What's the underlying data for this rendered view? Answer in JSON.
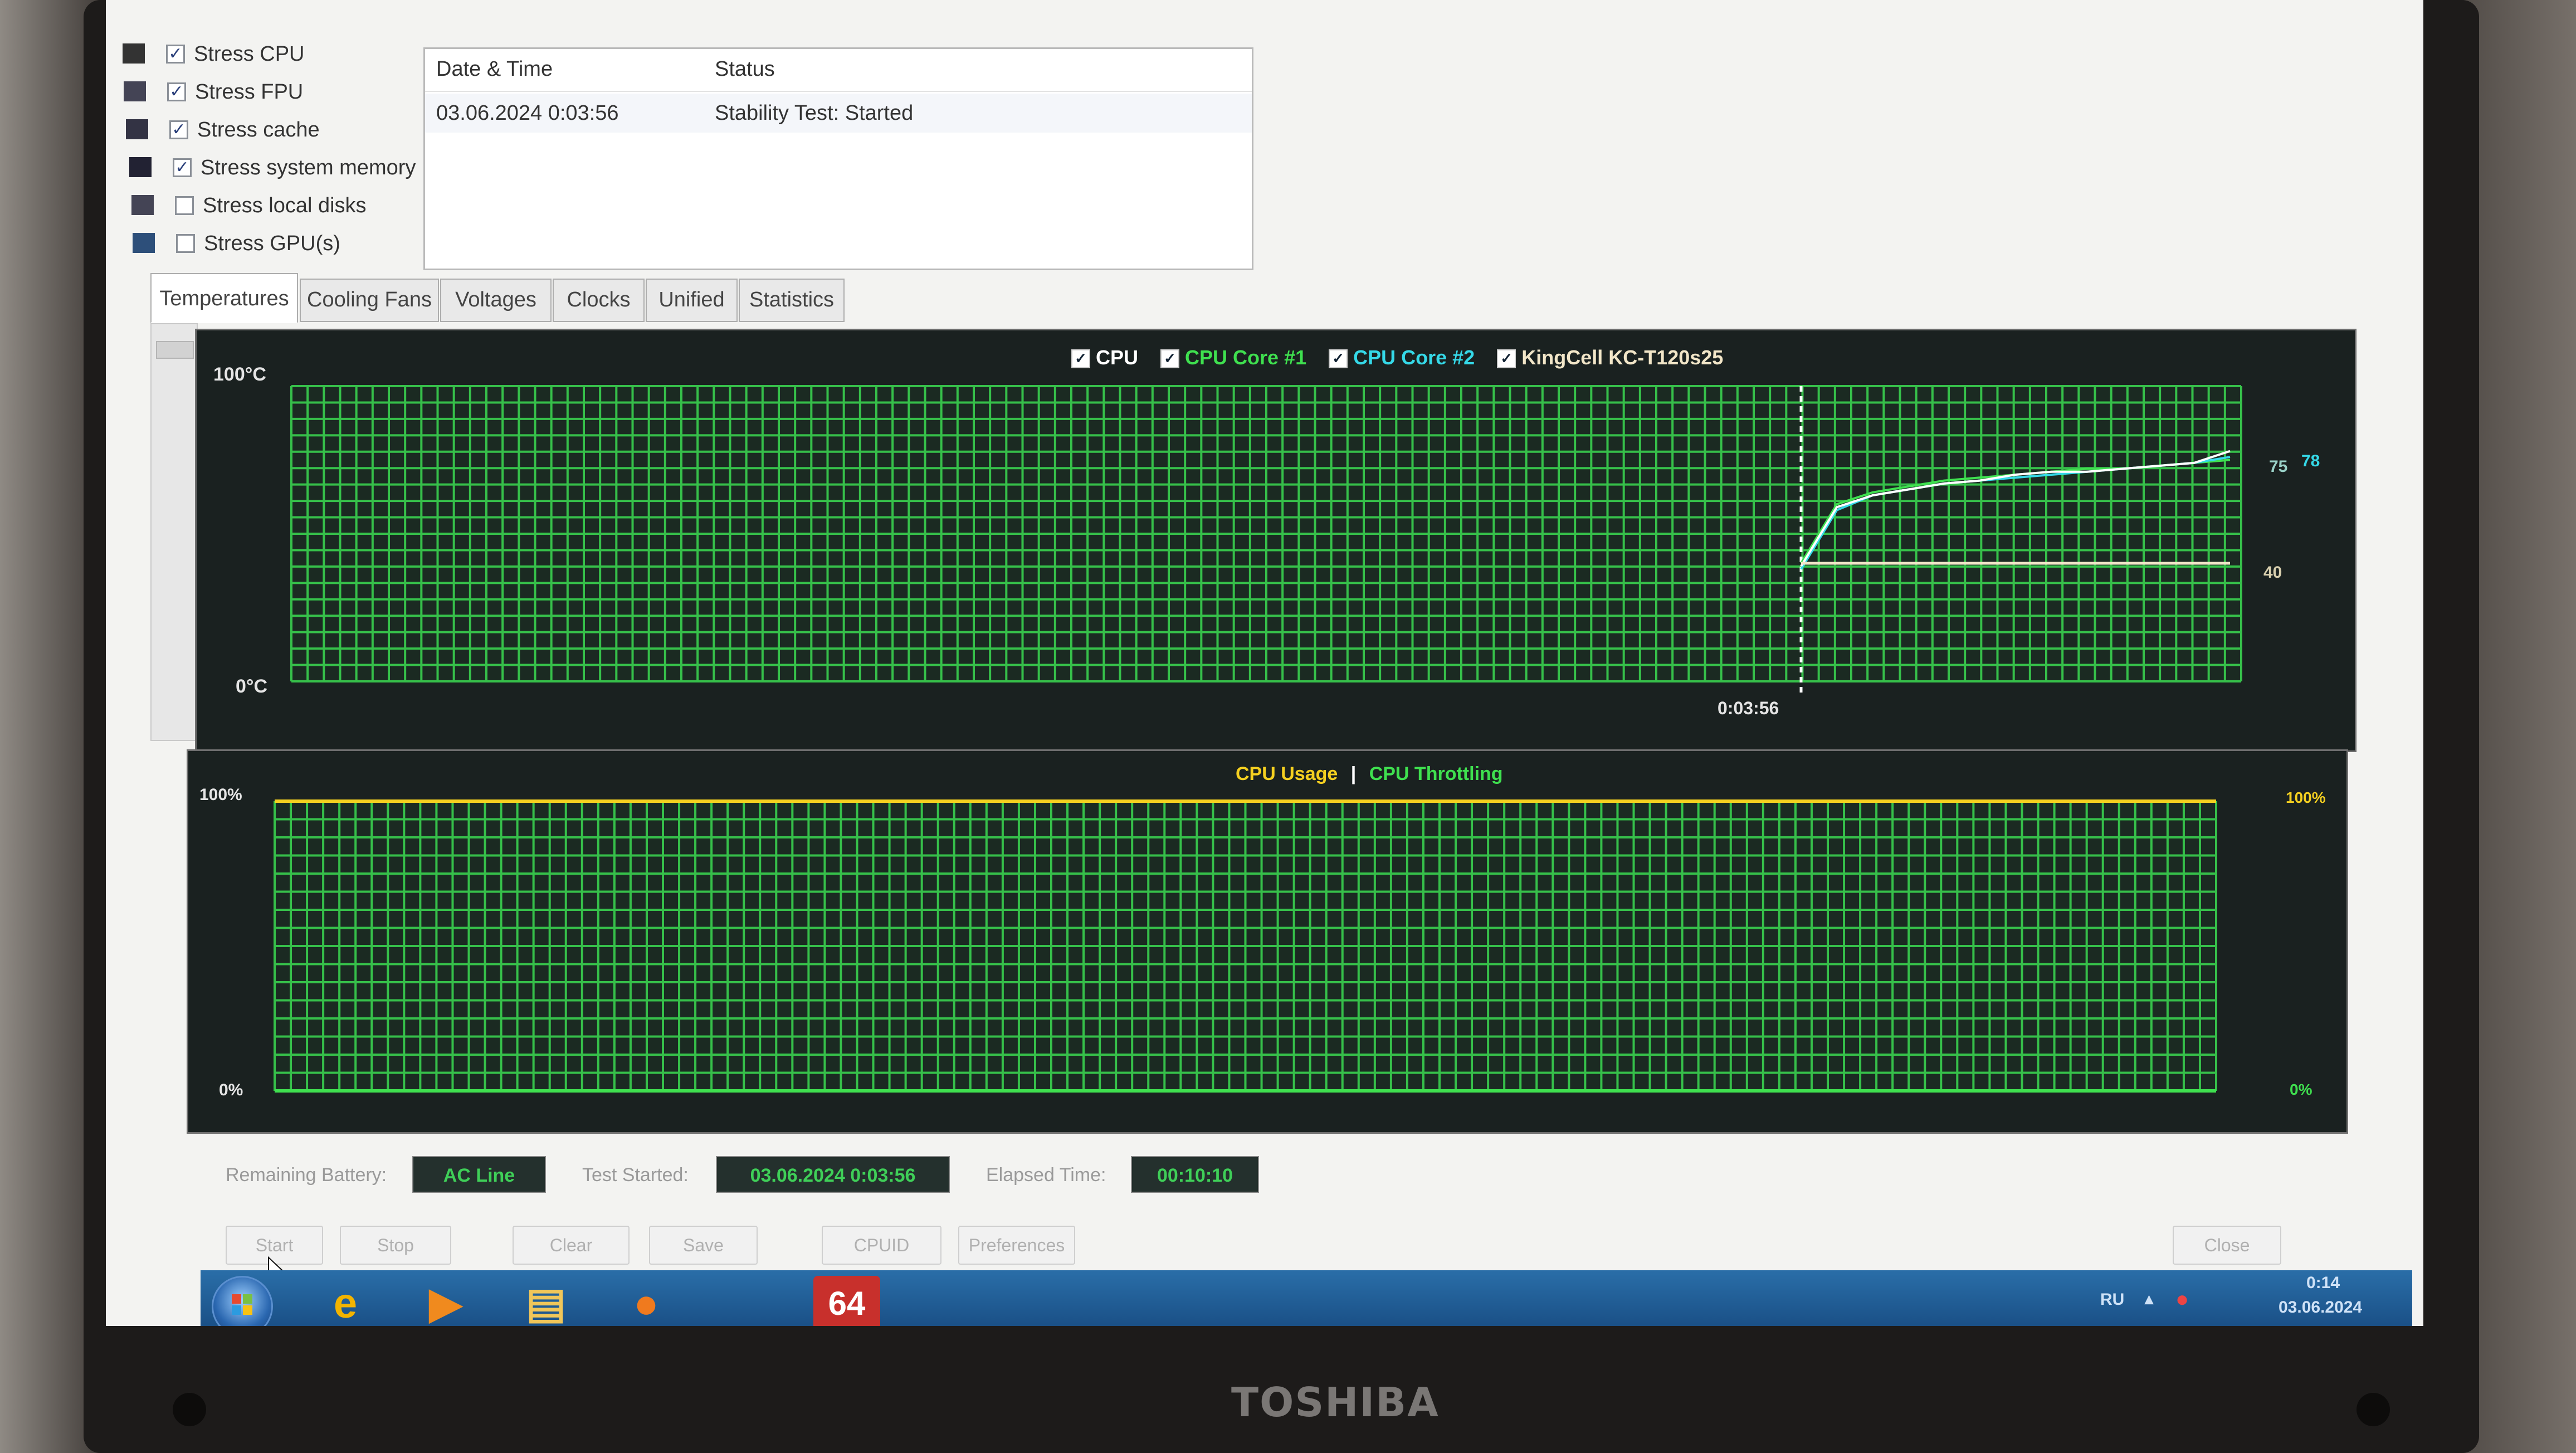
{
  "device": {
    "brand": "TOSHIBA"
  },
  "stress_options": [
    {
      "label": "Stress CPU",
      "checked": true,
      "icon": "cpu-icon"
    },
    {
      "label": "Stress FPU",
      "checked": true,
      "icon": "fpu-icon"
    },
    {
      "label": "Stress cache",
      "checked": true,
      "icon": "cache-icon"
    },
    {
      "label": "Stress system memory",
      "checked": true,
      "icon": "memory-icon"
    },
    {
      "label": "Stress local disks",
      "checked": false,
      "icon": "disk-icon"
    },
    {
      "label": "Stress GPU(s)",
      "checked": false,
      "icon": "gpu-icon"
    }
  ],
  "log": {
    "columns": [
      "Date & Time",
      "Status"
    ],
    "rows": [
      {
        "datetime": "03.06.2024 0:03:56",
        "status": "Stability Test: Started"
      }
    ]
  },
  "tabs": [
    {
      "label": "Temperatures",
      "active": true
    },
    {
      "label": "Cooling Fans",
      "active": false
    },
    {
      "label": "Voltages",
      "active": false
    },
    {
      "label": "Clocks",
      "active": false
    },
    {
      "label": "Unified",
      "active": false
    },
    {
      "label": "Statistics",
      "active": false
    }
  ],
  "temp_graph": {
    "legend": [
      {
        "label": "CPU",
        "color": "#ffffff"
      },
      {
        "label": "CPU Core #1",
        "color": "#3fe04f"
      },
      {
        "label": "CPU Core #2",
        "color": "#35d9e8"
      },
      {
        "label": "KingCell KC-T120s25",
        "color": "#f2e6c8"
      }
    ],
    "y_top_label": "100°C",
    "y_bottom_label": "0°C",
    "marker_time": "0:03:56",
    "end_labels": [
      "75",
      "78",
      "40"
    ]
  },
  "usage_graph": {
    "legend_usage": "CPU Usage",
    "legend_sep": "|",
    "legend_throttling": "CPU Throttling",
    "y_top_label": "100%",
    "y_bottom_label": "0%",
    "end_top_label": "100%",
    "end_bottom_label": "0%"
  },
  "chart_data": [
    {
      "type": "line",
      "ylim": [
        0,
        100
      ],
      "series": [
        {
          "name": "CPU Core #1",
          "color": "#3fe04f",
          "values": [
            40,
            60,
            64,
            66,
            68,
            69,
            70,
            71,
            72,
            72,
            73,
            74,
            75
          ]
        },
        {
          "name": "CPU Core #2",
          "color": "#35d9e8",
          "values": [
            38,
            58,
            63,
            65,
            67,
            68,
            69,
            70,
            71,
            72,
            73,
            74,
            76
          ]
        },
        {
          "name": "CPU",
          "color": "#ffffff",
          "values": [
            39,
            59,
            63,
            65,
            67,
            68,
            70,
            71,
            71,
            72,
            73,
            74,
            78
          ]
        },
        {
          "name": "KingCell KC-T120s25",
          "color": "#f2e6c8",
          "values": [
            40,
            40,
            40,
            40,
            40,
            40,
            40,
            40,
            40,
            40,
            40,
            40,
            40
          ]
        }
      ]
    },
    {
      "type": "line",
      "ylim": [
        0,
        100
      ],
      "series": [
        {
          "name": "CPU Usage",
          "color": "#f5d020",
          "values": [
            100,
            100
          ]
        },
        {
          "name": "CPU Throttling",
          "color": "#3fe04f",
          "values": [
            0,
            0
          ]
        }
      ]
    }
  ],
  "status_fields": {
    "battery_label": "Remaining Battery:",
    "battery_value": "AC Line",
    "started_label": "Test Started:",
    "started_value": "03.06.2024 0:03:56",
    "elapsed_label": "Elapsed Time:",
    "elapsed_value": "00:10:10"
  },
  "buttons": {
    "start": "Start",
    "stop": "Stop",
    "clear": "Clear",
    "save": "Save",
    "cpuid": "CPUID",
    "preferences": "Preferences",
    "close": "Close"
  },
  "taskbar": {
    "pinned": [
      {
        "name": "internet-explorer-icon",
        "glyph": "e",
        "color": "#f3b400"
      },
      {
        "name": "media-player-icon",
        "glyph": "▶",
        "color": "#f08a1e"
      },
      {
        "name": "file-explorer-icon",
        "glyph": "▤",
        "color": "#f0c65a"
      },
      {
        "name": "firefox-icon",
        "glyph": "●",
        "color": "#f07a1e"
      },
      {
        "name": "aida64-icon",
        "glyph": "64",
        "color": "#ffffff"
      }
    ],
    "lang": "RU",
    "time": "0:14",
    "date": "03.06.2024"
  }
}
